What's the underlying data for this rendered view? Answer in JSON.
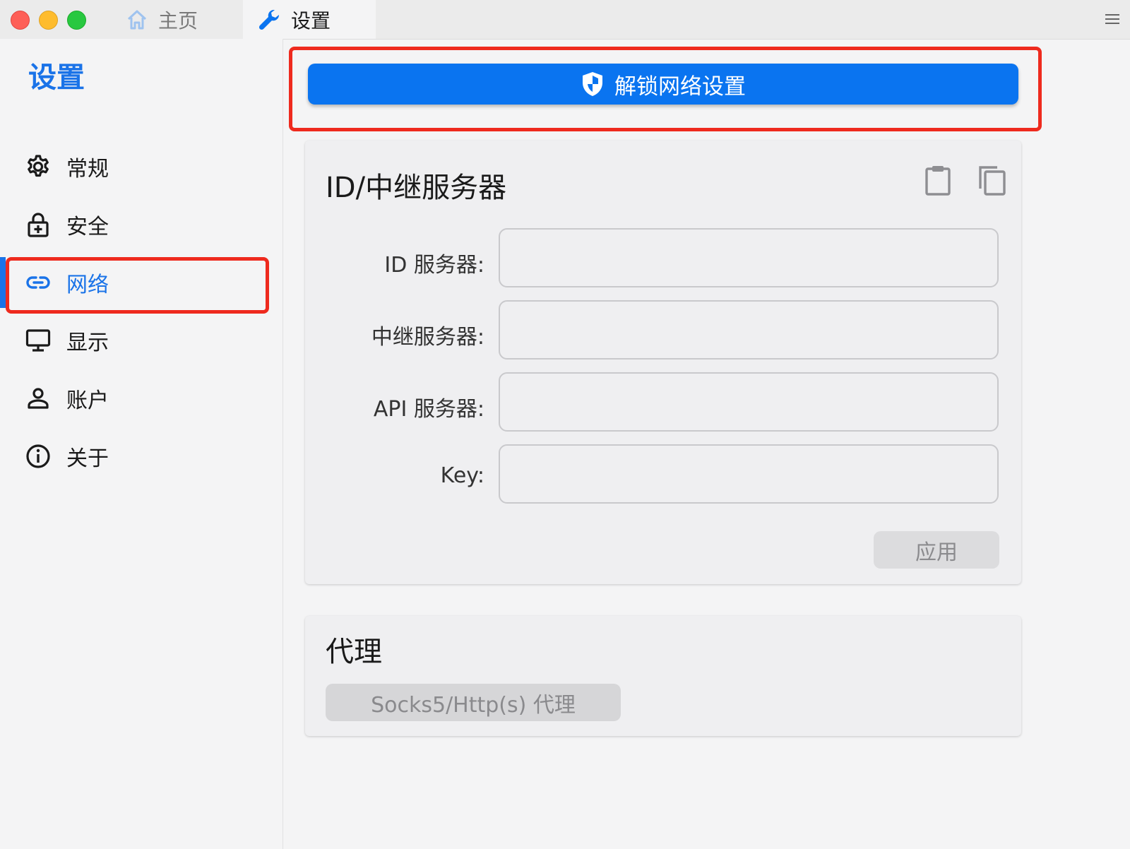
{
  "titlebar": {
    "tabs": [
      {
        "label": "主页",
        "icon": "home-icon",
        "active": false
      },
      {
        "label": "设置",
        "icon": "wrench-icon",
        "active": true
      }
    ]
  },
  "sidebar": {
    "title": "设置",
    "items": [
      {
        "label": "常规",
        "icon": "gear-icon"
      },
      {
        "label": "安全",
        "icon": "lock-icon"
      },
      {
        "label": "网络",
        "icon": "link-icon",
        "active": true
      },
      {
        "label": "显示",
        "icon": "monitor-icon"
      },
      {
        "label": "账户",
        "icon": "person-icon"
      },
      {
        "label": "关于",
        "icon": "info-icon"
      }
    ]
  },
  "main": {
    "unlock_button": "解锁网络设置",
    "server_card": {
      "title": "ID/中继服务器",
      "fields": [
        {
          "label": "ID 服务器:",
          "value": ""
        },
        {
          "label": "中继服务器:",
          "value": ""
        },
        {
          "label": "API 服务器:",
          "value": ""
        },
        {
          "label": "Key:",
          "value": ""
        }
      ],
      "apply_button": "应用"
    },
    "proxy_card": {
      "title": "代理",
      "proxy_button": "Socks5/Http(s) 代理"
    }
  },
  "colors": {
    "accent": "#1a73e8",
    "unlock_button": "#0a74f0",
    "highlight": "#ee2a1e"
  }
}
